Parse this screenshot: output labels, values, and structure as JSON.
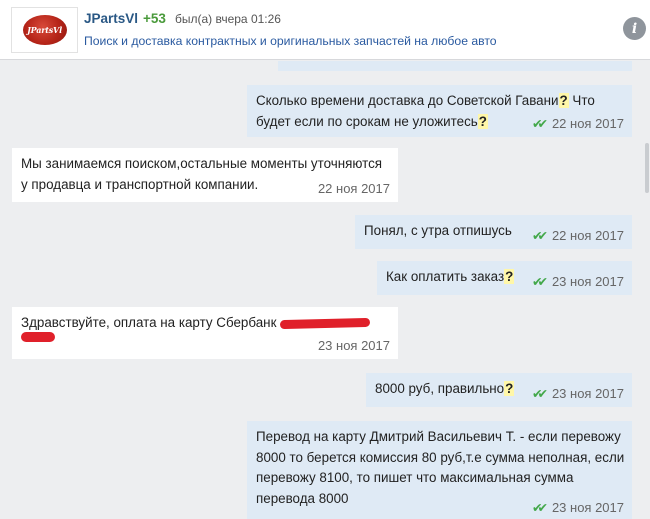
{
  "header": {
    "name": "JPartsVl",
    "rating": "+53",
    "status": "был(а) вчера 01:26",
    "description": "Поиск и доставка контрактных и оригинальных запчастей на любое авто",
    "avatar_text": "JPartsVl",
    "info_icon": "i"
  },
  "messages": [
    {
      "direction": "out",
      "text_parts": [
        "Сколько времени доставка до Советской Гавани",
        "?",
        " Что будет если по срокам не уложитесь",
        "?"
      ],
      "date": "22 ноя 2017",
      "read": true
    },
    {
      "direction": "in",
      "text": "Мы занимаемся поиском,остальные моменты уточняются у продавца и транспортной компании.",
      "date": "22 ноя 2017"
    },
    {
      "direction": "out",
      "text": "Понял, с утра отпишусь",
      "date": "22 ноя 2017",
      "read": true
    },
    {
      "direction": "out",
      "text_parts": [
        "Как оплатить заказ",
        "?"
      ],
      "date": "23 ноя 2017",
      "read": true
    },
    {
      "direction": "in",
      "text": "Здравствуйте, оплата на карту Сбербанк",
      "redacted": true,
      "date": "23 ноя 2017"
    },
    {
      "direction": "out",
      "text_parts": [
        "8000 руб, правильно",
        "?"
      ],
      "date": "23 ноя 2017",
      "read": true
    },
    {
      "direction": "out",
      "text": "Перевод на карту Дмитрий Васильевич Т. - если перевожу 8000 то берется комиссия 80 руб,т.е сумма неполная, если перевожу 8100, то пишет что максимальная сумма перевода 8000",
      "date": "23 ноя 2017",
      "read": true
    }
  ],
  "colors": {
    "outgoing_bg": "#dfeaf5",
    "incoming_bg": "#ffffff",
    "chat_bg": "#edeef0",
    "name_color": "#2a5885",
    "rating_color": "#4a9a3b",
    "read_check_color": "#43a84a",
    "redaction_color": "#e0202a"
  },
  "icons": [
    "info-icon",
    "double-check-icon",
    "logo-avatar"
  ]
}
